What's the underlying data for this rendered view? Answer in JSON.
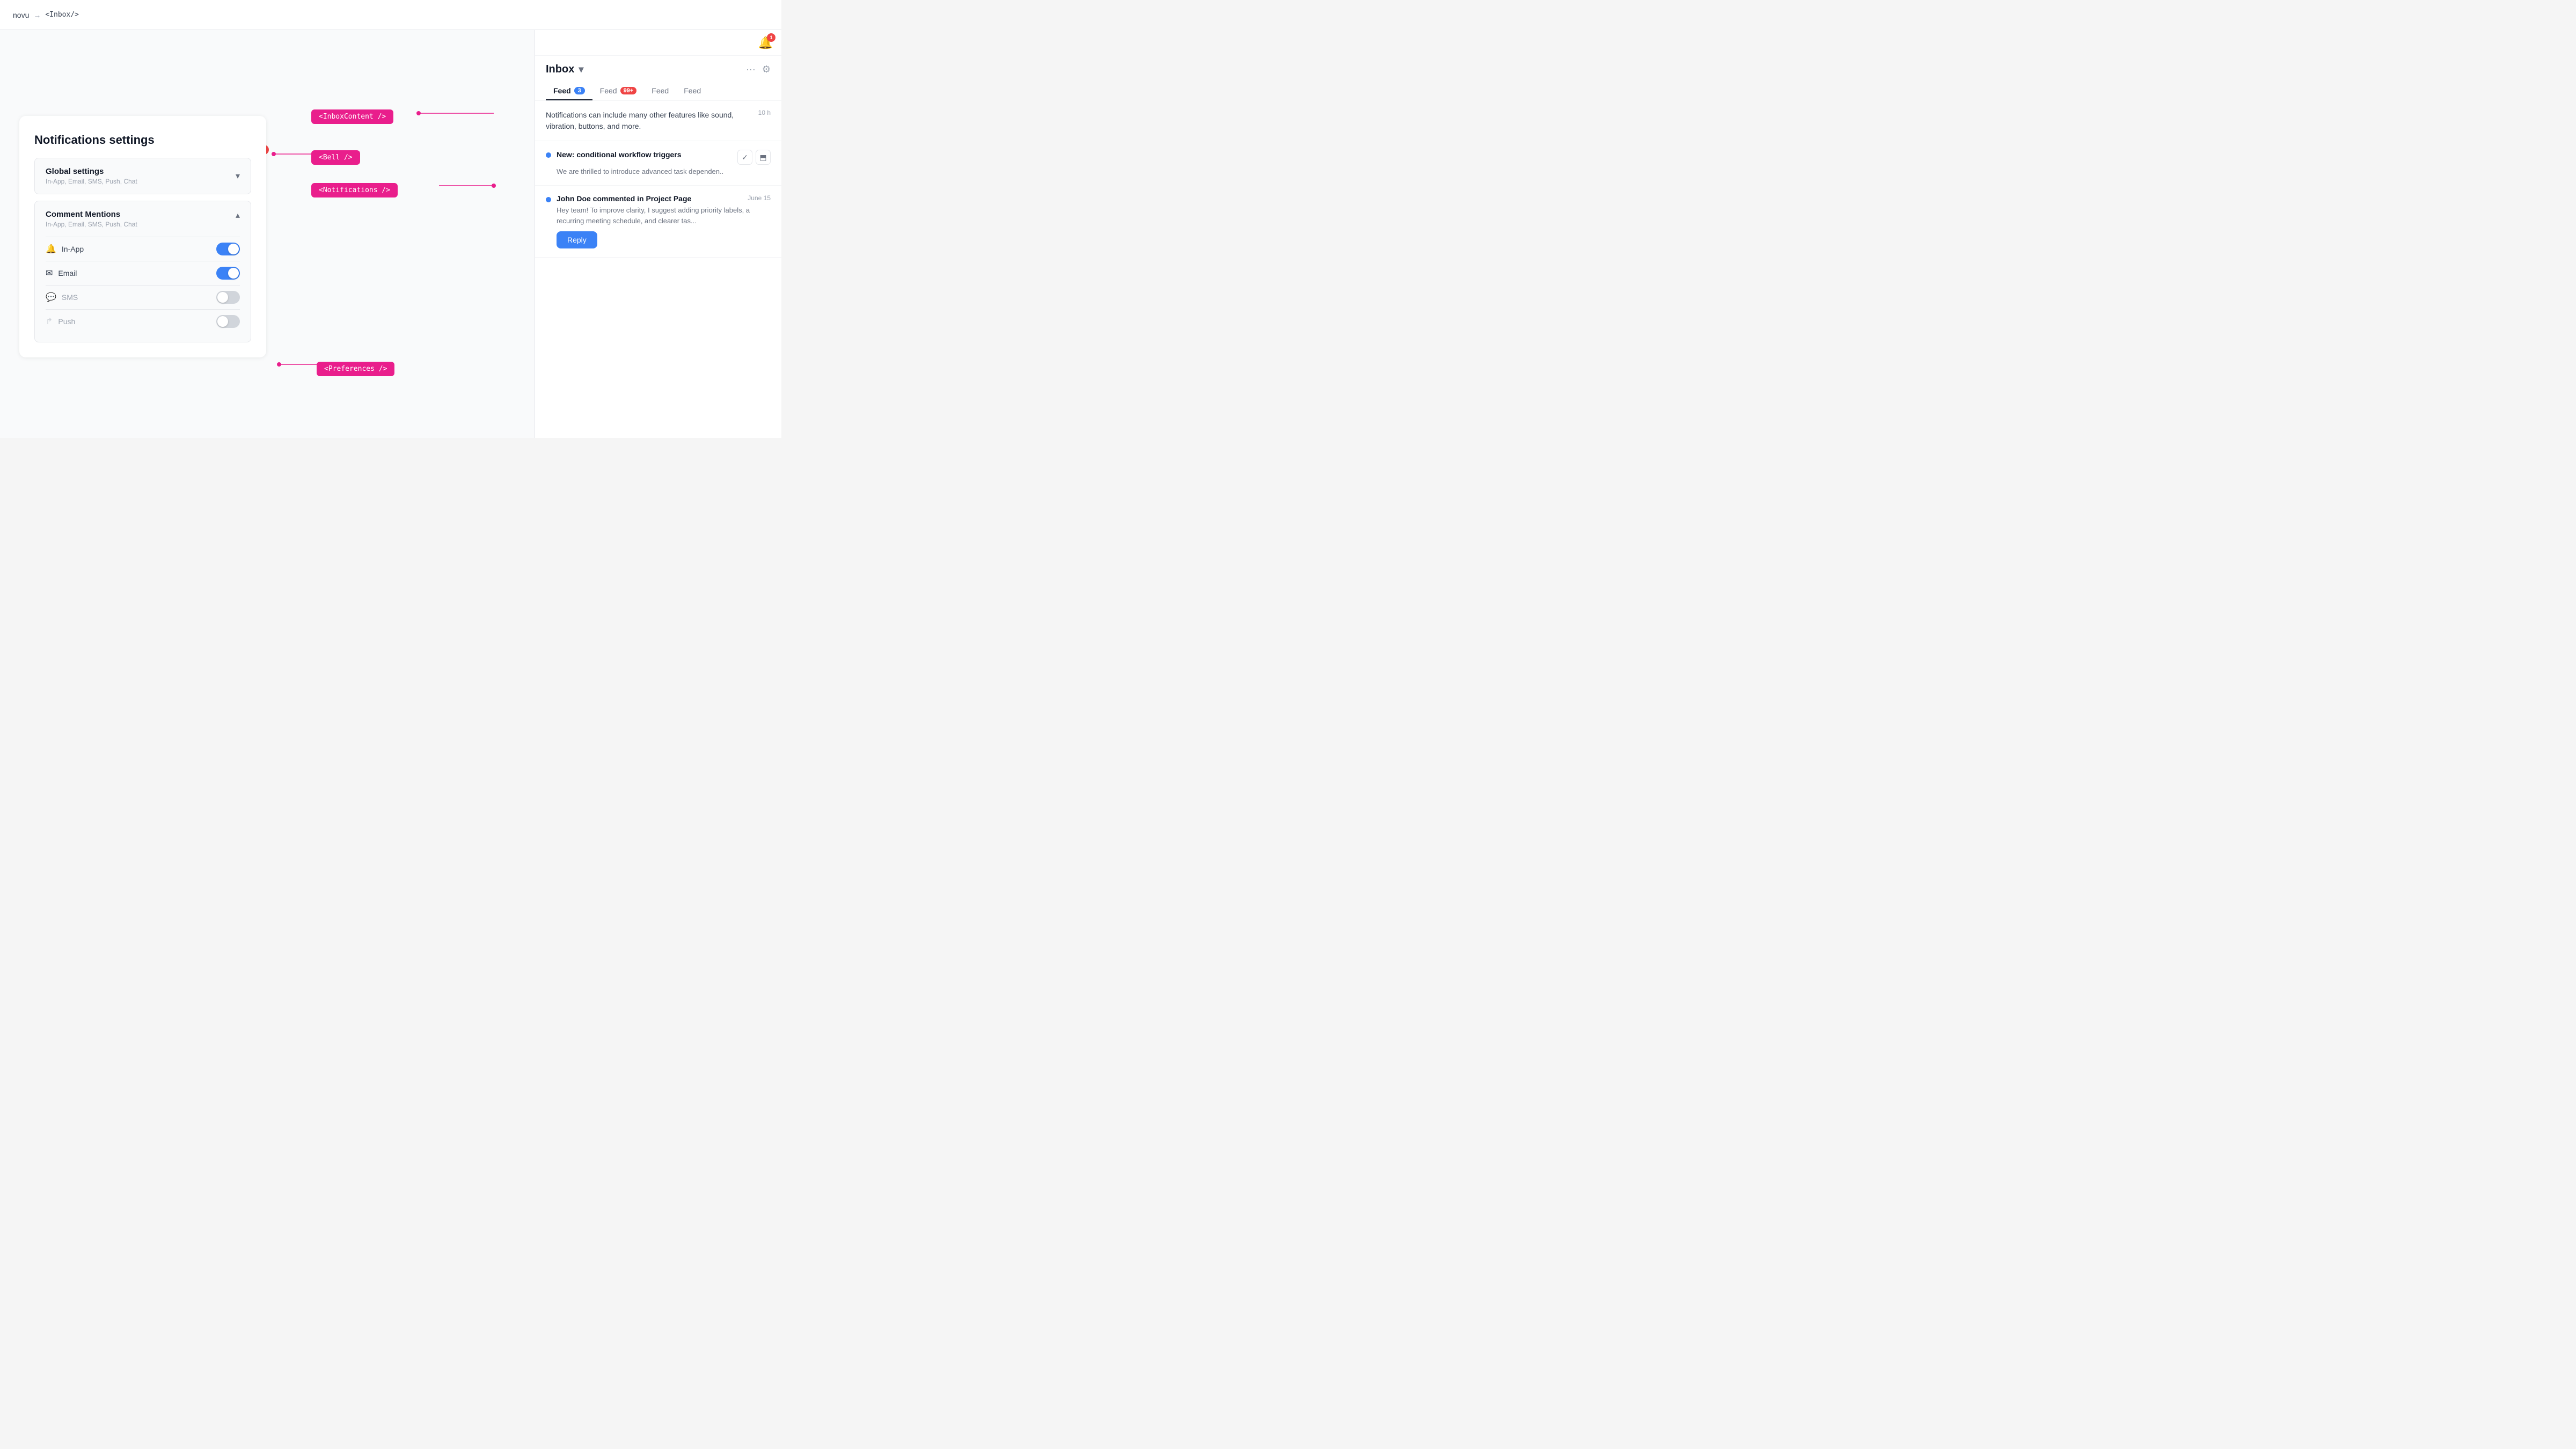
{
  "nav": {
    "brand": "novu",
    "arrow": "→",
    "page": "<Inbox/>"
  },
  "code_tags": {
    "inbox_content": "<InboxContent />",
    "bell": "<Bell />",
    "notifications": "<Notifications />",
    "preferences": "<Preferences />"
  },
  "notifications_settings": {
    "title": "Notifications settings",
    "global_settings": {
      "title": "Global settings",
      "subtitle": "In-App, Email, SMS, Push, Chat",
      "expanded": false
    },
    "comment_mentions": {
      "title": "Comment Mentions",
      "subtitle": "In-App, Email, SMS, Push, Chat",
      "expanded": true,
      "channels": [
        {
          "icon": "🔔",
          "label": "In-App",
          "enabled": true,
          "muted": false
        },
        {
          "icon": "✉",
          "label": "Email",
          "enabled": true,
          "muted": false
        },
        {
          "icon": "💬",
          "label": "SMS",
          "enabled": false,
          "muted": true
        },
        {
          "icon": "↱",
          "label": "Push",
          "enabled": false,
          "muted": true
        }
      ]
    }
  },
  "inbox": {
    "title": "Inbox",
    "bell_count": "1",
    "tabs": [
      {
        "label": "Feed",
        "badge": "3",
        "badge_color": "blue",
        "active": true
      },
      {
        "label": "Feed",
        "badge": "99+",
        "badge_color": "red",
        "active": false
      },
      {
        "label": "Feed",
        "badge": null,
        "active": false
      },
      {
        "label": "Feed",
        "badge": null,
        "active": false
      }
    ],
    "plain_notification": {
      "text": "Notifications can include many other features like sound, vibration, buttons, and more.",
      "time": "10 h"
    },
    "notification_1": {
      "title": "New: conditional workflow triggers",
      "description": "We are thrilled to introduce advanced task dependen..",
      "dot": true
    },
    "notification_2": {
      "title": "John Doe commented in Project Page",
      "date": "June 15",
      "text": "Hey team! To improve clarity, I suggest adding priority labels, a recurring meeting schedule, and clearer tas...",
      "reply_label": "Reply",
      "dot": true
    }
  }
}
